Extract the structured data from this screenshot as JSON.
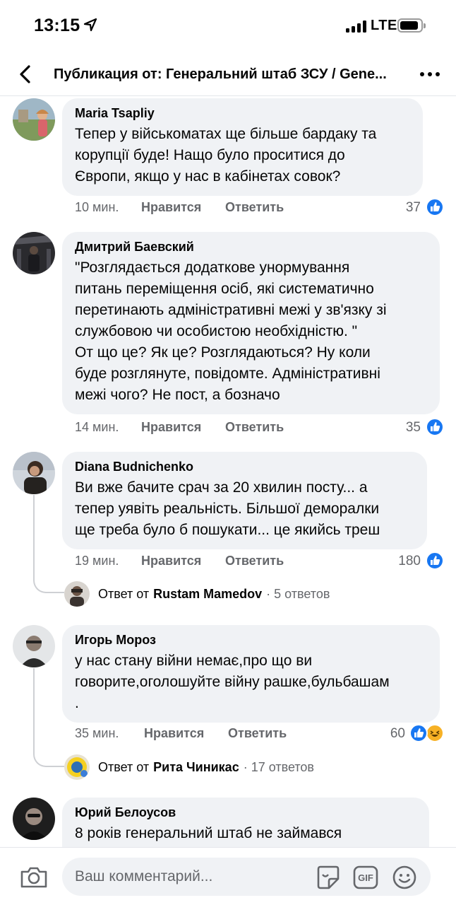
{
  "status_bar": {
    "time": "13:15",
    "network": "LTE"
  },
  "header": {
    "title": "Публикация от: Генеральний штаб ЗСУ / Gene..."
  },
  "comments": [
    {
      "author": "Maria Tsapliy",
      "text": "Тепер у військоматах ще більше бардаку та\nкорупції буде! Нащо було проситися до\nЄвропи, якщо у нас в кабінетах совок?",
      "time": "10 мин.",
      "like_label": "Нравится",
      "reply_label": "Ответить",
      "reactions": "37"
    },
    {
      "author": "Дмитрий Баевский",
      "text": "\"Розглядається додаткове унормування\nпитань переміщення осіб, які систематично\nперетинають адміністративні межі у зв'язку зі\nслужбовою чи особистою необхідністю. \"\nОт що це? Як це? Розглядаються? Ну коли\nбуде розглянуте, повідомте. Адміністративні\nмежі чого? Не пост, а бозначо",
      "time": "14 мин.",
      "like_label": "Нравится",
      "reply_label": "Ответить",
      "reactions": "35"
    },
    {
      "author": "Diana Budnichenko",
      "text": "Ви вже бачите срач за 20 хвилин посту... а\nтепер уявіть реальність. Більшої деморалки\nще треба було б пошукати... це якийсь треш",
      "time": "19 мин.",
      "like_label": "Нравится",
      "reply_label": "Ответить",
      "reactions": "180",
      "reply": {
        "prefix": "Ответ от",
        "name": "Rustam Mamedov",
        "count": "· 5 ответов"
      }
    },
    {
      "author": "Игорь Мороз",
      "text": "у нас стану війни немає,про що ви\nговорите,оголошуйте війну рашке,бульбашам\n.",
      "time": "35 мин.",
      "like_label": "Нравится",
      "reply_label": "Ответить",
      "reactions": "60",
      "reply": {
        "prefix": "Ответ от",
        "name": "Рита Чиникас",
        "count": "· 17 ответов"
      }
    },
    {
      "author": "Юрий Белоусов",
      "text": "8 років генеральний штаб не займався"
    }
  ],
  "composer": {
    "placeholder": "Ваш комментарий..."
  },
  "colors": {
    "accent": "#1877f2",
    "bubble": "#f0f2f5",
    "meta_text": "#65676b",
    "haha": "#f7b125"
  },
  "icons": [
    "location-arrow-icon",
    "back-chevron-icon",
    "more-dots-icon",
    "like-reaction-icon",
    "haha-reaction-icon",
    "camera-icon",
    "sticker-icon",
    "gif-icon",
    "emoji-icon"
  ]
}
